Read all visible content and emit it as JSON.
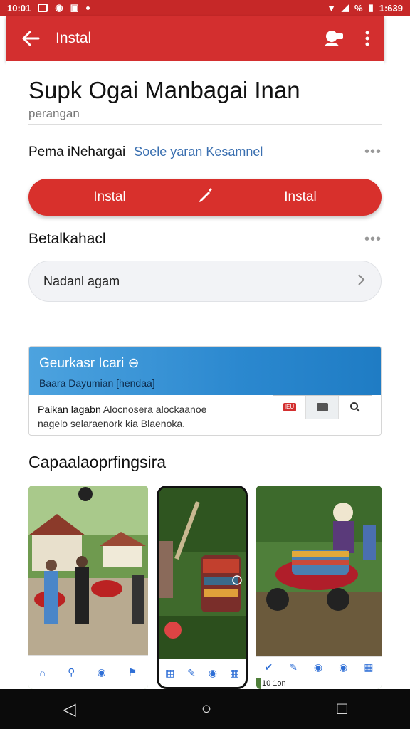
{
  "status_bar": {
    "time": "10:01",
    "clock_right": "1:639",
    "battery_label": "%",
    "icons": [
      "box-icon",
      "circle-icon",
      "camera-icon",
      "dot-icon",
      "wifi-icon",
      "signal-icon",
      "battery-icon"
    ]
  },
  "app_bar": {
    "title": "Instal",
    "back_icon": "arrow-left-icon",
    "actions": [
      "account-chat-icon",
      "more-vert-icon"
    ],
    "color": "#d32f2f"
  },
  "app": {
    "title": "Supk Ogai Manbagai Inan",
    "subtitle": "perangan"
  },
  "developer": {
    "name": "Pema iNehargai",
    "link": "Soele yaran Kesamnel",
    "more": "•••"
  },
  "install_bar": {
    "left_label": "Instal",
    "right_label": "Instal",
    "icon": "pen-icon",
    "color": "#d8302c"
  },
  "section": {
    "title": "Betalkahacl",
    "more": "•••",
    "select_label": "Nadanl agam"
  },
  "card": {
    "header_title": "Geurkasr Icari ⊖",
    "header_sub": "Baara Dayumian [hendaa]",
    "body_line1_bold": "Paikan lagabn",
    "body_line1": "Alocnosera alockaanoe",
    "body_line2": "nagelo selaraenork kia",
    "body_line2_tail": "Blaenoka.",
    "tool_red_label": "IEU",
    "tool_icons": [
      "flag-icon",
      "image-icon",
      "search-icon"
    ]
  },
  "screenshots": {
    "title": "Capaalaoprfingsira",
    "shot3_footer": "10  1on"
  },
  "system_nav": {
    "back": "◁",
    "home": "○",
    "recents": "□"
  }
}
